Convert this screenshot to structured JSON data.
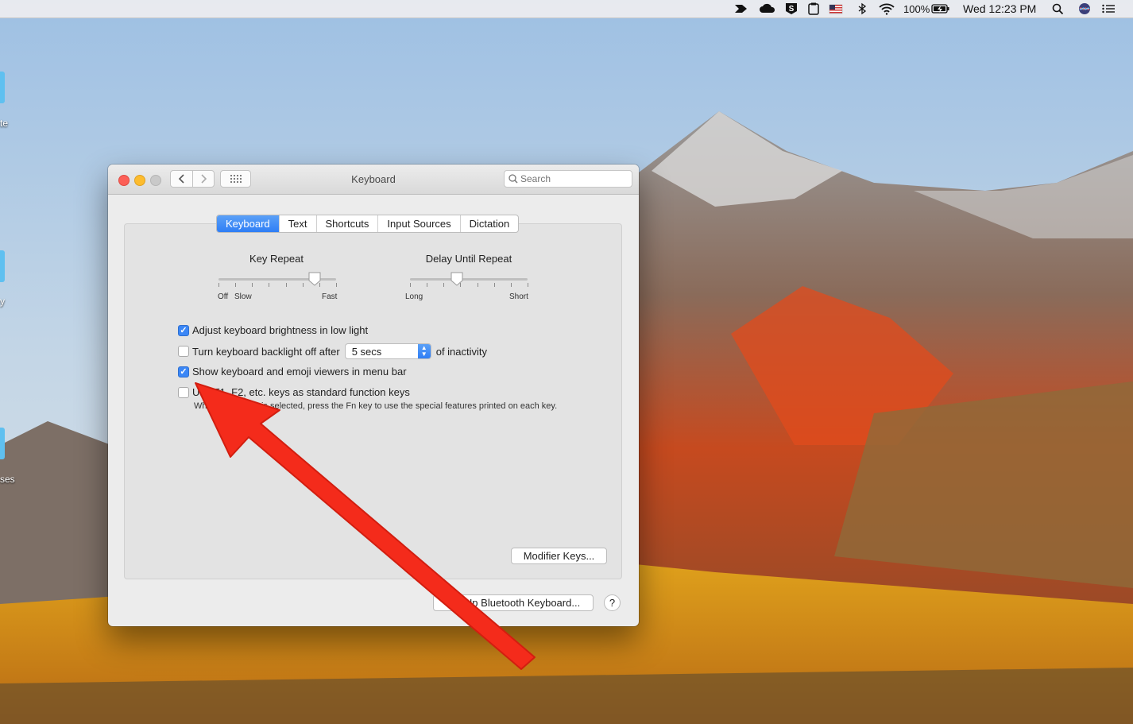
{
  "menubar": {
    "battery": "100%",
    "clock": "Wed 12:23 PM",
    "icons": [
      "arrow-icon",
      "cloud-icon",
      "s-icon",
      "clipboard-icon",
      "us-flag-icon",
      "bluetooth-icon",
      "wifi-icon",
      "battery-icon",
      "spotlight-icon",
      "siri-icon",
      "notification-center-icon"
    ]
  },
  "desktop": {
    "icon_labels": [
      "te",
      "y",
      "ses"
    ]
  },
  "window": {
    "title": "Keyboard",
    "search_placeholder": "Search",
    "tabs": [
      {
        "label": "Keyboard",
        "active": true
      },
      {
        "label": "Text",
        "active": false
      },
      {
        "label": "Shortcuts",
        "active": false
      },
      {
        "label": "Input Sources",
        "active": false
      },
      {
        "label": "Dictation",
        "active": false
      }
    ],
    "key_repeat": {
      "title": "Key Repeat",
      "left_labels": [
        "Off",
        "Slow"
      ],
      "right_label": "Fast",
      "value_fraction": 0.82
    },
    "delay_until_repeat": {
      "title": "Delay Until Repeat",
      "left_label": "Long",
      "right_label": "Short",
      "value_fraction": 0.4
    },
    "options": [
      {
        "label": "Adjust keyboard brightness in low light",
        "checked": true
      },
      {
        "label": "Turn keyboard backlight off after",
        "checked": false,
        "select_value": "5 secs",
        "suffix": "of inactivity"
      },
      {
        "label": "Show keyboard and emoji viewers in menu bar",
        "checked": true
      },
      {
        "label": "Use F1, F2, etc. keys as standard function keys",
        "checked": false
      }
    ],
    "fn_note": "When this option is selected, press the Fn key to use the special features printed on each key.",
    "modifier_button": "Modifier Keys...",
    "bluetooth_button": "Set Up Bluetooth Keyboard...",
    "help_button": "?"
  },
  "colors": {
    "accent": "#2f7ef5",
    "arrow": "#f42b1b",
    "close": "#fc5f57",
    "minimize": "#fdbc2e",
    "zoom": "#c9c9c9"
  }
}
